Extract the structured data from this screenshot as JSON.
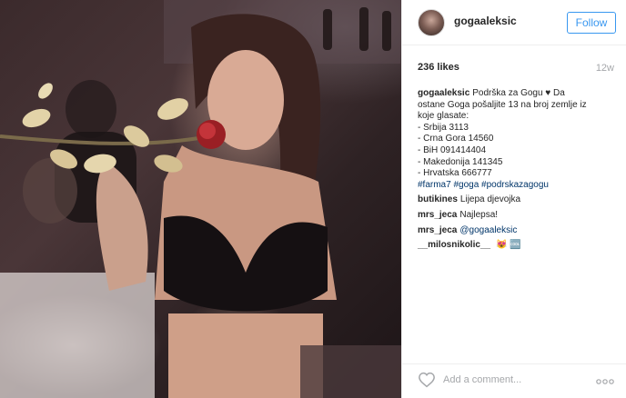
{
  "post": {
    "username": "gogaaleksic",
    "follow_label": "Follow",
    "likes": "236 likes",
    "time_ago": "12w",
    "caption": {
      "user": "gogaaleksic",
      "lines": [
        "Podrška za Gogu ♥ Da",
        "ostane Goga pošaljite 13 na broj zemlje iz",
        "koje glasate:",
        "- Srbija 3113",
        "- Crna Gora 14560",
        "- BiH 091414404",
        "- Makedonija 141345",
        "- Hrvatska 666777"
      ],
      "hashtags": "#farma7 #goga #podrskazagogu"
    },
    "comments": [
      {
        "user": "butikines",
        "text": "Lijepa djevojka"
      },
      {
        "user": "mrs_jeca",
        "text": "Najlepsa!"
      },
      {
        "user": "mrs_jeca",
        "text": "@gogaaleksic"
      },
      {
        "user": "__milosnikolic__",
        "text": "😻 🆒"
      }
    ],
    "add_comment_placeholder": "Add a comment...",
    "icons": {
      "like": "heart-icon",
      "more": "more-options-icon"
    },
    "colors": {
      "accent": "#3897f0",
      "link": "#003569",
      "muted": "#a5a7aa"
    }
  }
}
